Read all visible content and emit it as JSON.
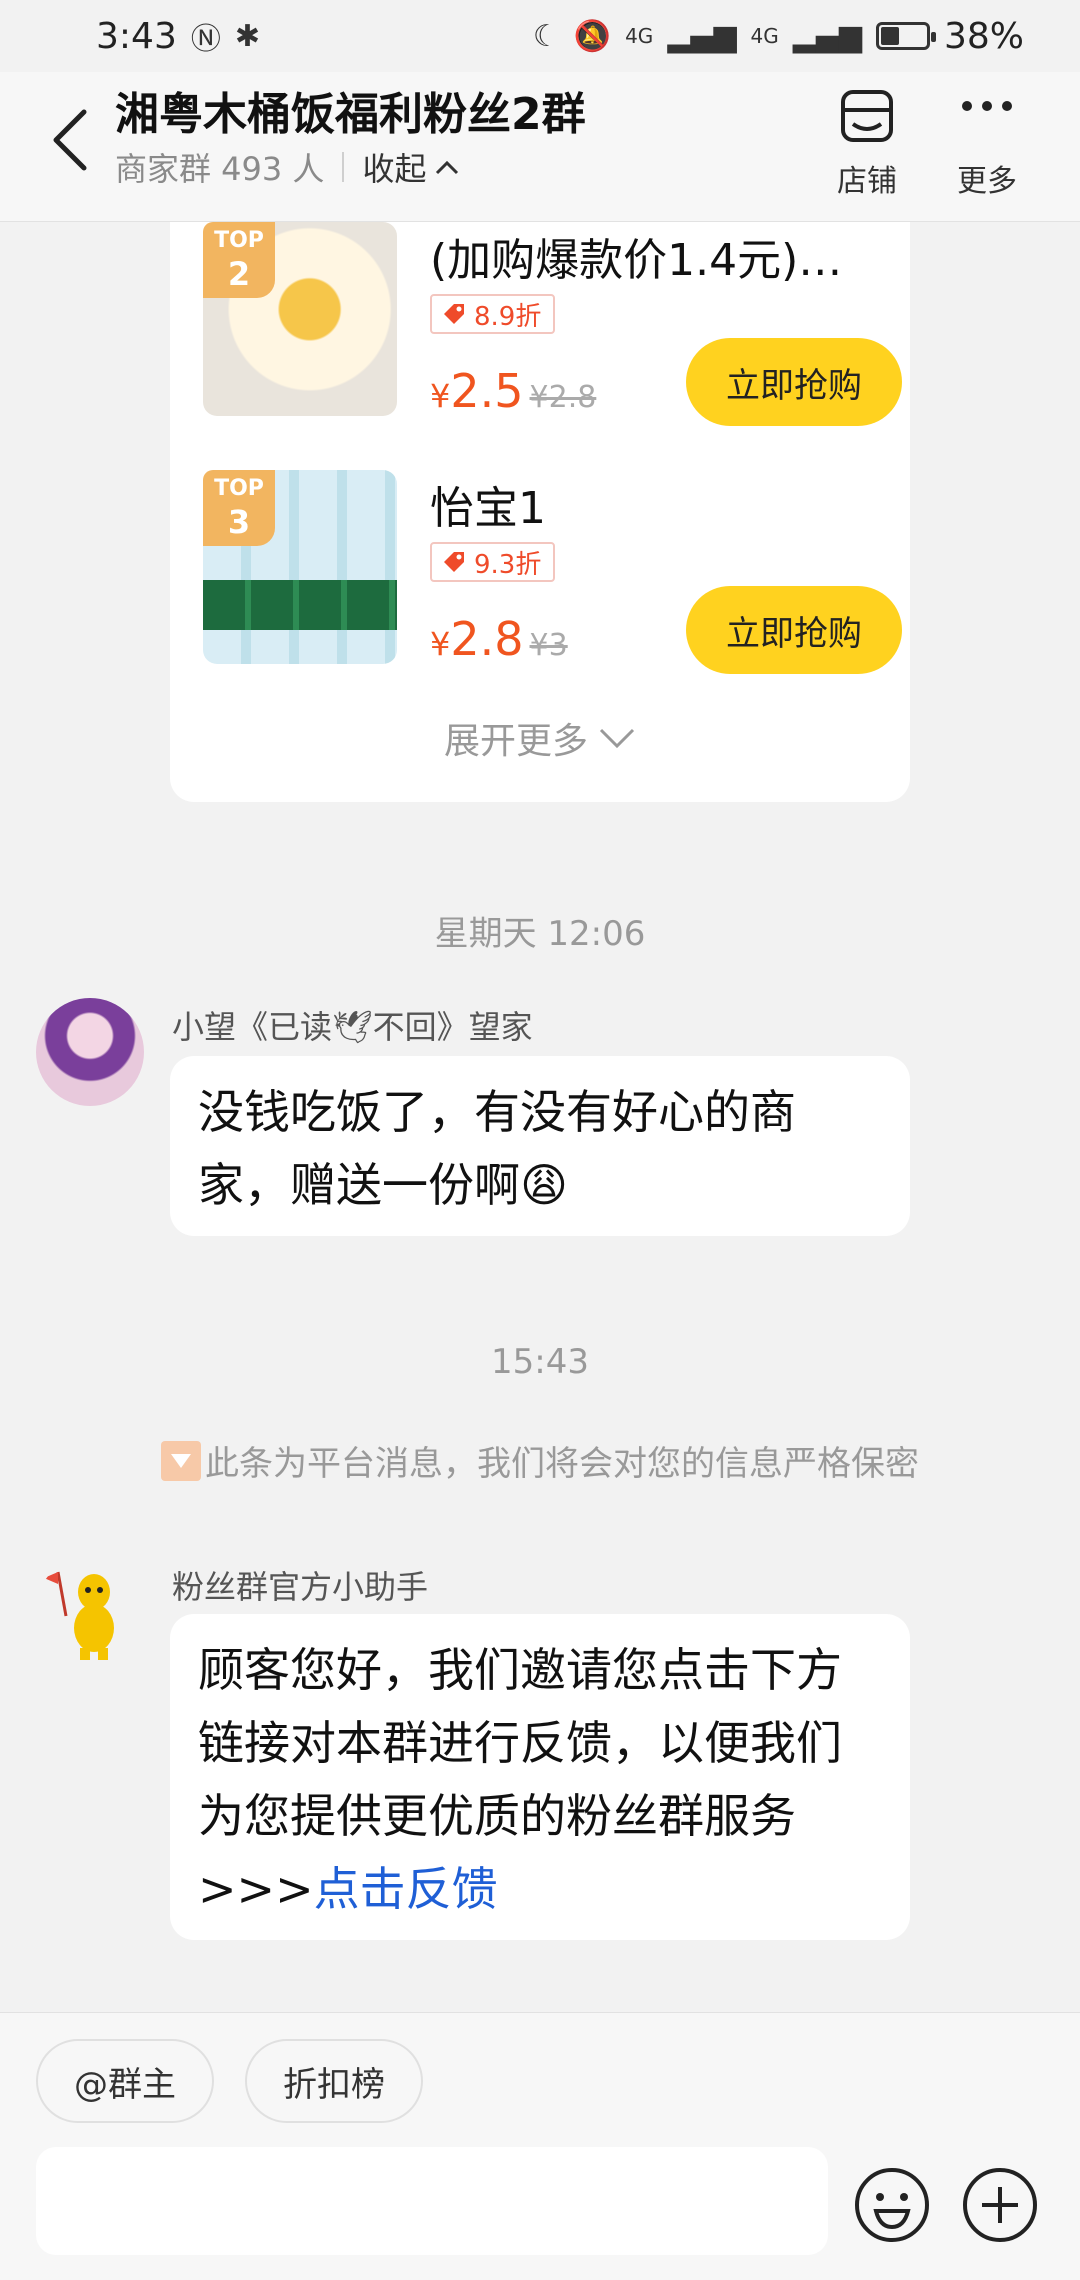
{
  "status_bar": {
    "time": "3:43",
    "battery": "38%",
    "network_1": "4G",
    "network_2": "4G"
  },
  "header": {
    "title": "湘粤木桶饭福利粉丝2群",
    "member_count": "商家群 493 人",
    "collapse_label": "收起",
    "store_label": "店铺",
    "more_label": "更多"
  },
  "products": [
    {
      "rank_top": "TOP",
      "rank_num": "2",
      "name": "(加购爆款价1.4元)…",
      "discount": "8.9折",
      "price_symbol": "¥",
      "price": "2.5",
      "original_price": "¥2.8",
      "button": "立即抢购"
    },
    {
      "rank_top": "TOP",
      "rank_num": "3",
      "name": "怡宝1",
      "discount": "9.3折",
      "price_symbol": "¥",
      "price": "2.8",
      "original_price": "¥3",
      "button": "立即抢购"
    }
  ],
  "expand_more": "展开更多",
  "messages": {
    "time_1": "星期天 12:06",
    "user_sender": "小望《已读🕊不回》望家",
    "user_text": "没钱吃饭了，有没有好心的商家，赠送一份啊😩",
    "time_2": "15:43",
    "system_note": "此条为平台消息，我们将会对您的信息严格保密",
    "bot_sender": "粉丝群官方小助手",
    "bot_text": "顾客您好，我们邀请您点击下方链接对本群进行反馈，以便我们为您提供更优质的粉丝群服务>>>",
    "bot_link": "点击反馈"
  },
  "bottom": {
    "chip_owner": "@群主",
    "chip_rank": "折扣榜",
    "input_placeholder": ""
  },
  "colors": {
    "accent_yellow": "#ffd21f",
    "price_red": "#f0551f",
    "link_blue": "#1f5fd6",
    "badge_orange": "#f2b560"
  }
}
